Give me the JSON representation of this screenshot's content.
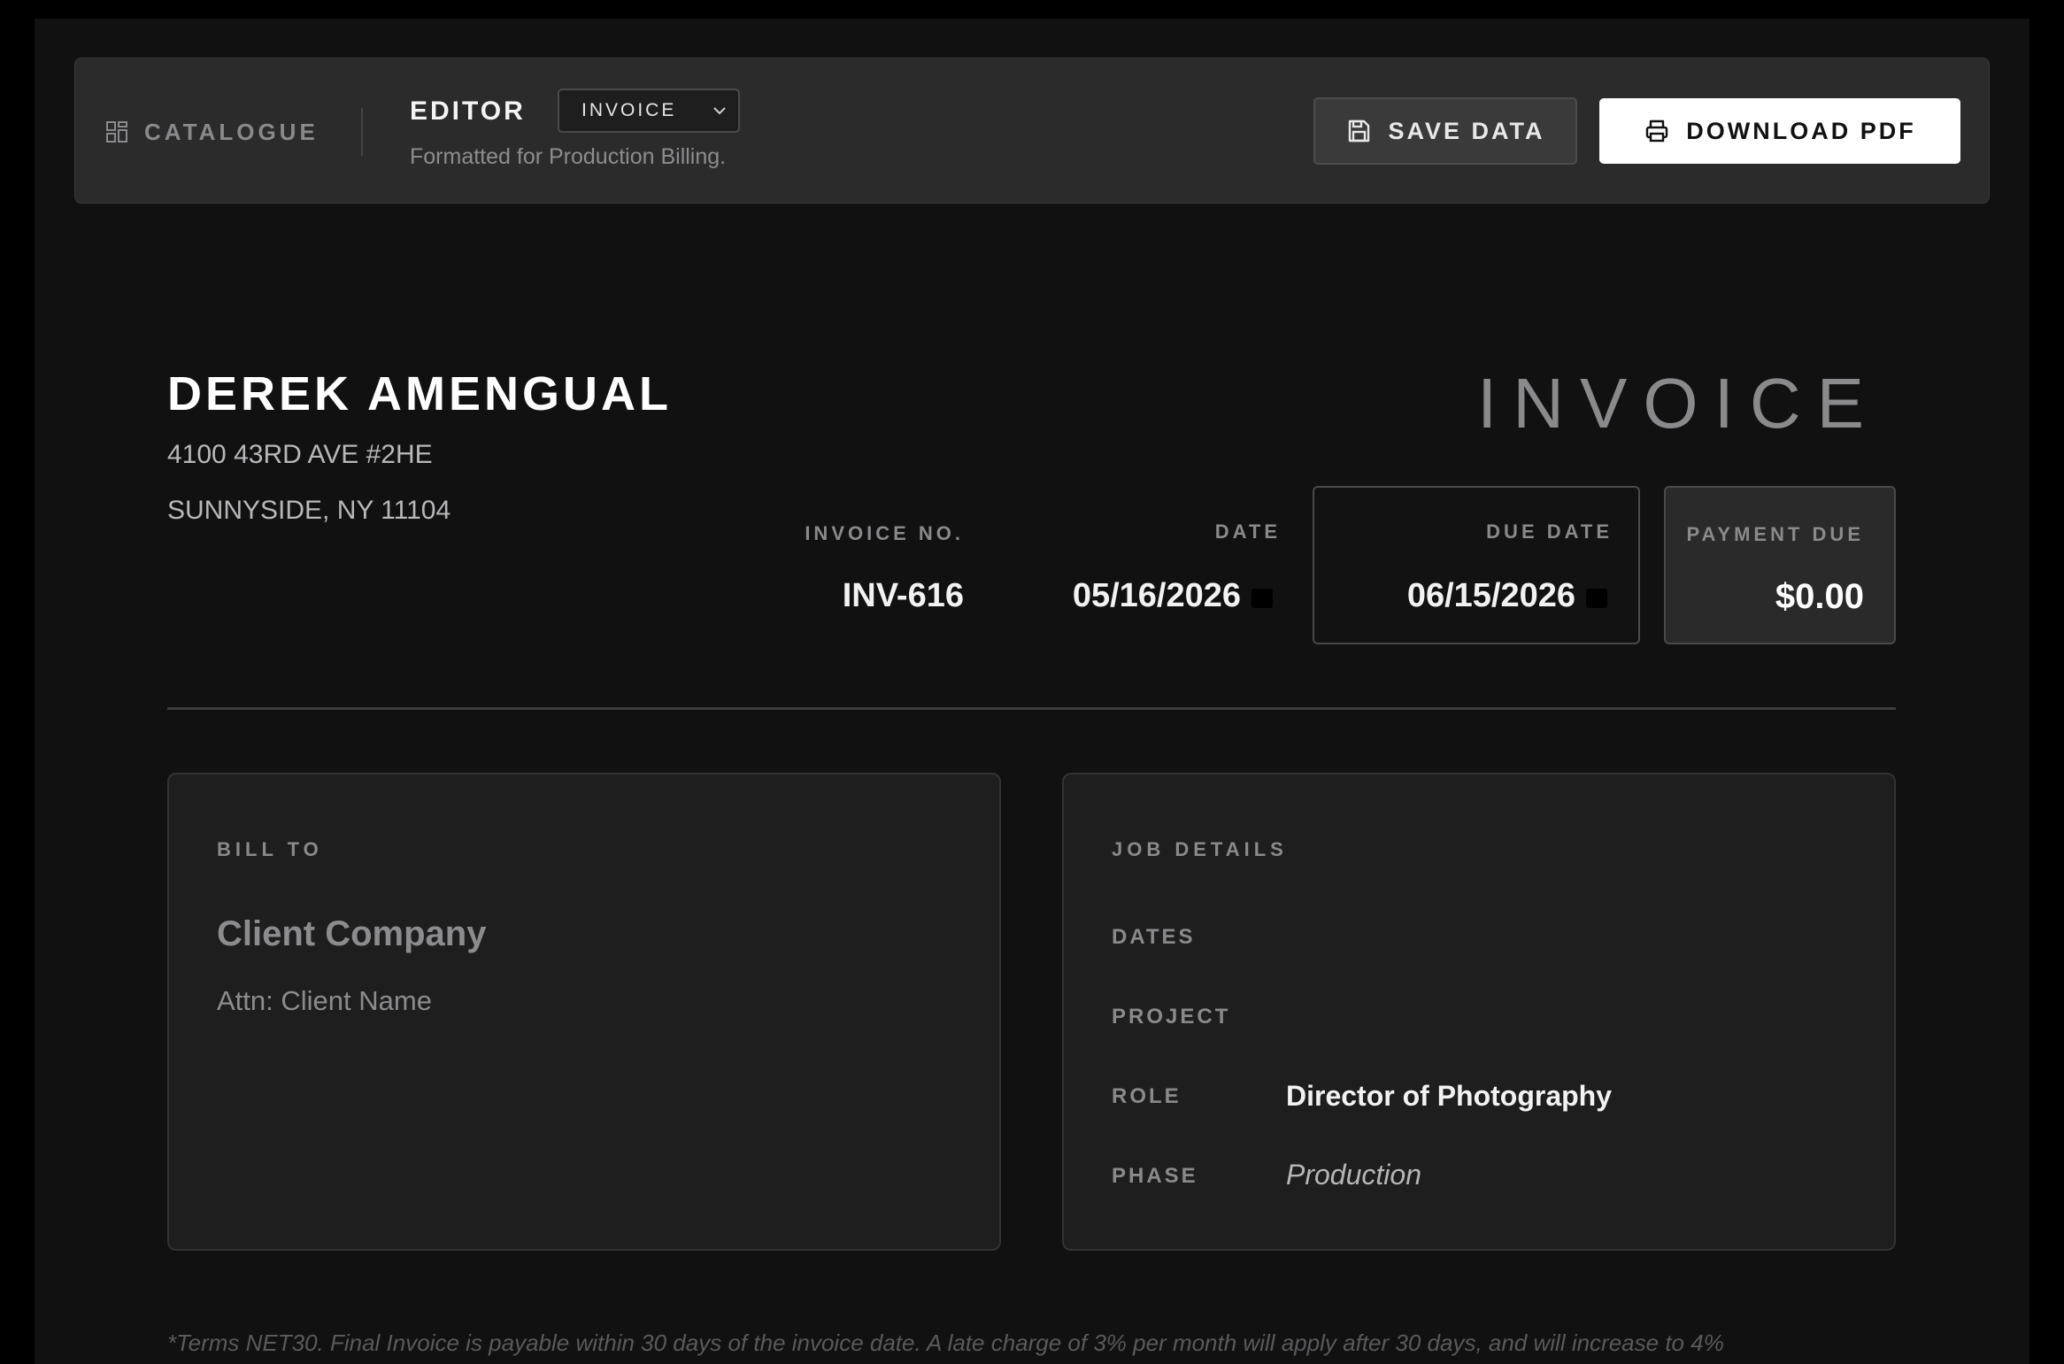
{
  "toolbar": {
    "catalogue_label": "CATALOGUE",
    "catalogue_icon": "grid-icon",
    "editor_label": "EDITOR",
    "document_type": "INVOICE",
    "subtitle": "Formatted for Production Billing.",
    "save_label": "SAVE DATA",
    "save_icon": "save-icon",
    "download_label": "DOWNLOAD PDF",
    "download_icon": "printer-icon"
  },
  "sender": {
    "name": "DEREK AMENGUAL",
    "address_line1": "4100 43RD AVE #2HE",
    "address_line2": "SUNNYSIDE, NY 11104"
  },
  "document": {
    "title": "INVOICE",
    "invoice_no_label": "INVOICE NO.",
    "invoice_no": "INV-616",
    "date_label": "DATE",
    "date": "05/16/2026",
    "due_date_label": "DUE DATE",
    "due_date": "06/15/2026",
    "payment_due_label": "PAYMENT DUE",
    "payment_due": "$0.00"
  },
  "bill_to": {
    "heading": "BILL TO",
    "company": "Client Company",
    "attn": "Attn: Client Name"
  },
  "job_details": {
    "heading": "JOB DETAILS",
    "dates_label": "DATES",
    "dates_value": "",
    "project_label": "PROJECT",
    "project_value": "",
    "role_label": "ROLE",
    "role_value": "Director of Photography",
    "phase_label": "PHASE",
    "phase_value": "Production"
  },
  "terms": "*Terms NET30. Final Invoice is payable within 30 days of the invoice date. A late charge of 3% per month will apply after 30 days, and will increase to 4%",
  "colors": {
    "background": "#111112",
    "toolbar": "#2b2b2c",
    "card": "#1e1e1f",
    "primary_button": "#ffffff"
  }
}
